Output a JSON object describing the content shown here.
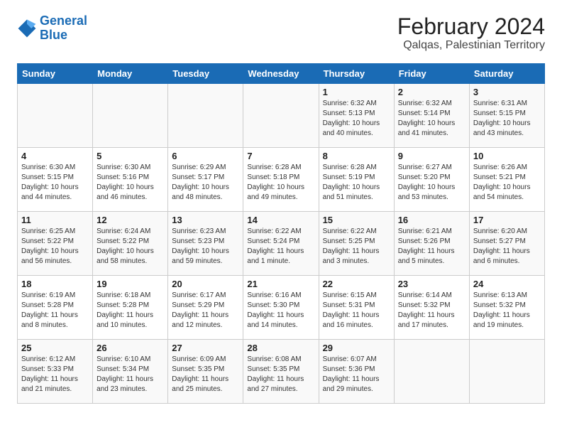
{
  "logo": {
    "line1": "General",
    "line2": "Blue"
  },
  "title": "February 2024",
  "subtitle": "Qalqas, Palestinian Territory",
  "header": {
    "days": [
      "Sunday",
      "Monday",
      "Tuesday",
      "Wednesday",
      "Thursday",
      "Friday",
      "Saturday"
    ]
  },
  "weeks": [
    [
      {
        "day": "",
        "sunrise": "",
        "sunset": "",
        "daylight": ""
      },
      {
        "day": "",
        "sunrise": "",
        "sunset": "",
        "daylight": ""
      },
      {
        "day": "",
        "sunrise": "",
        "sunset": "",
        "daylight": ""
      },
      {
        "day": "",
        "sunrise": "",
        "sunset": "",
        "daylight": ""
      },
      {
        "day": "1",
        "sunrise": "Sunrise: 6:32 AM",
        "sunset": "Sunset: 5:13 PM",
        "daylight": "Daylight: 10 hours and 40 minutes."
      },
      {
        "day": "2",
        "sunrise": "Sunrise: 6:32 AM",
        "sunset": "Sunset: 5:14 PM",
        "daylight": "Daylight: 10 hours and 41 minutes."
      },
      {
        "day": "3",
        "sunrise": "Sunrise: 6:31 AM",
        "sunset": "Sunset: 5:15 PM",
        "daylight": "Daylight: 10 hours and 43 minutes."
      }
    ],
    [
      {
        "day": "4",
        "sunrise": "Sunrise: 6:30 AM",
        "sunset": "Sunset: 5:15 PM",
        "daylight": "Daylight: 10 hours and 44 minutes."
      },
      {
        "day": "5",
        "sunrise": "Sunrise: 6:30 AM",
        "sunset": "Sunset: 5:16 PM",
        "daylight": "Daylight: 10 hours and 46 minutes."
      },
      {
        "day": "6",
        "sunrise": "Sunrise: 6:29 AM",
        "sunset": "Sunset: 5:17 PM",
        "daylight": "Daylight: 10 hours and 48 minutes."
      },
      {
        "day": "7",
        "sunrise": "Sunrise: 6:28 AM",
        "sunset": "Sunset: 5:18 PM",
        "daylight": "Daylight: 10 hours and 49 minutes."
      },
      {
        "day": "8",
        "sunrise": "Sunrise: 6:28 AM",
        "sunset": "Sunset: 5:19 PM",
        "daylight": "Daylight: 10 hours and 51 minutes."
      },
      {
        "day": "9",
        "sunrise": "Sunrise: 6:27 AM",
        "sunset": "Sunset: 5:20 PM",
        "daylight": "Daylight: 10 hours and 53 minutes."
      },
      {
        "day": "10",
        "sunrise": "Sunrise: 6:26 AM",
        "sunset": "Sunset: 5:21 PM",
        "daylight": "Daylight: 10 hours and 54 minutes."
      }
    ],
    [
      {
        "day": "11",
        "sunrise": "Sunrise: 6:25 AM",
        "sunset": "Sunset: 5:22 PM",
        "daylight": "Daylight: 10 hours and 56 minutes."
      },
      {
        "day": "12",
        "sunrise": "Sunrise: 6:24 AM",
        "sunset": "Sunset: 5:22 PM",
        "daylight": "Daylight: 10 hours and 58 minutes."
      },
      {
        "day": "13",
        "sunrise": "Sunrise: 6:23 AM",
        "sunset": "Sunset: 5:23 PM",
        "daylight": "Daylight: 10 hours and 59 minutes."
      },
      {
        "day": "14",
        "sunrise": "Sunrise: 6:22 AM",
        "sunset": "Sunset: 5:24 PM",
        "daylight": "Daylight: 11 hours and 1 minute."
      },
      {
        "day": "15",
        "sunrise": "Sunrise: 6:22 AM",
        "sunset": "Sunset: 5:25 PM",
        "daylight": "Daylight: 11 hours and 3 minutes."
      },
      {
        "day": "16",
        "sunrise": "Sunrise: 6:21 AM",
        "sunset": "Sunset: 5:26 PM",
        "daylight": "Daylight: 11 hours and 5 minutes."
      },
      {
        "day": "17",
        "sunrise": "Sunrise: 6:20 AM",
        "sunset": "Sunset: 5:27 PM",
        "daylight": "Daylight: 11 hours and 6 minutes."
      }
    ],
    [
      {
        "day": "18",
        "sunrise": "Sunrise: 6:19 AM",
        "sunset": "Sunset: 5:28 PM",
        "daylight": "Daylight: 11 hours and 8 minutes."
      },
      {
        "day": "19",
        "sunrise": "Sunrise: 6:18 AM",
        "sunset": "Sunset: 5:28 PM",
        "daylight": "Daylight: 11 hours and 10 minutes."
      },
      {
        "day": "20",
        "sunrise": "Sunrise: 6:17 AM",
        "sunset": "Sunset: 5:29 PM",
        "daylight": "Daylight: 11 hours and 12 minutes."
      },
      {
        "day": "21",
        "sunrise": "Sunrise: 6:16 AM",
        "sunset": "Sunset: 5:30 PM",
        "daylight": "Daylight: 11 hours and 14 minutes."
      },
      {
        "day": "22",
        "sunrise": "Sunrise: 6:15 AM",
        "sunset": "Sunset: 5:31 PM",
        "daylight": "Daylight: 11 hours and 16 minutes."
      },
      {
        "day": "23",
        "sunrise": "Sunrise: 6:14 AM",
        "sunset": "Sunset: 5:32 PM",
        "daylight": "Daylight: 11 hours and 17 minutes."
      },
      {
        "day": "24",
        "sunrise": "Sunrise: 6:13 AM",
        "sunset": "Sunset: 5:32 PM",
        "daylight": "Daylight: 11 hours and 19 minutes."
      }
    ],
    [
      {
        "day": "25",
        "sunrise": "Sunrise: 6:12 AM",
        "sunset": "Sunset: 5:33 PM",
        "daylight": "Daylight: 11 hours and 21 minutes."
      },
      {
        "day": "26",
        "sunrise": "Sunrise: 6:10 AM",
        "sunset": "Sunset: 5:34 PM",
        "daylight": "Daylight: 11 hours and 23 minutes."
      },
      {
        "day": "27",
        "sunrise": "Sunrise: 6:09 AM",
        "sunset": "Sunset: 5:35 PM",
        "daylight": "Daylight: 11 hours and 25 minutes."
      },
      {
        "day": "28",
        "sunrise": "Sunrise: 6:08 AM",
        "sunset": "Sunset: 5:35 PM",
        "daylight": "Daylight: 11 hours and 27 minutes."
      },
      {
        "day": "29",
        "sunrise": "Sunrise: 6:07 AM",
        "sunset": "Sunset: 5:36 PM",
        "daylight": "Daylight: 11 hours and 29 minutes."
      },
      {
        "day": "",
        "sunrise": "",
        "sunset": "",
        "daylight": ""
      },
      {
        "day": "",
        "sunrise": "",
        "sunset": "",
        "daylight": ""
      }
    ]
  ]
}
